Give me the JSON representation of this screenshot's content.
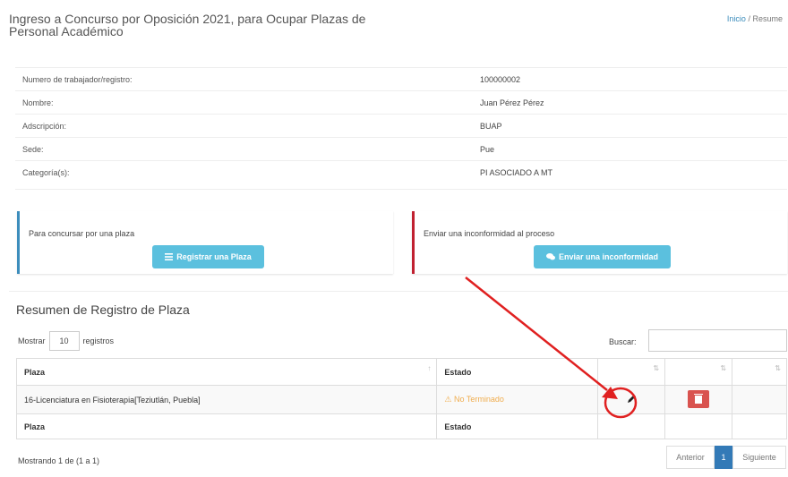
{
  "header": {
    "title": "Ingreso a Concurso por Oposición 2021, para Ocupar Plazas de Personal Académico",
    "breadcrumb_home": "Inicio",
    "breadcrumb_sep": "/",
    "breadcrumb_current": "Resume"
  },
  "info": {
    "rows": [
      {
        "label": "Numero de trabajador/registro:",
        "value": "100000002"
      },
      {
        "label": "Nombre:",
        "value": "Juan Pérez Pérez"
      },
      {
        "label": "Adscripción:",
        "value": "BUAP"
      },
      {
        "label": "Sede:",
        "value": "Pue"
      },
      {
        "label": "Categoría(s):",
        "value": "PI ASOCIADO A MT"
      }
    ]
  },
  "cards": {
    "left_text": "Para concursar por una plaza",
    "left_button": "Registrar una Plaza",
    "right_text": "Enviar una inconformidad al proceso",
    "right_button": "Enviar una inconformidad"
  },
  "section": {
    "title": "Resumen de Registro de Plaza",
    "show_label": "Mostrar",
    "show_value": "10",
    "records_label": "registros",
    "search_label": "Buscar:",
    "search_value": ""
  },
  "table": {
    "columns": [
      "Plaza",
      "Estado"
    ],
    "rows": [
      {
        "plaza": "16-Licenciatura en Fisioterapia[Teziutlán, Puebla]",
        "estado": "No Terminado"
      }
    ],
    "footer": [
      "Plaza",
      "Estado"
    ]
  },
  "pagination": {
    "info": "Mostrando 1 de (1 a 1)",
    "prev": "Anterior",
    "current": "1",
    "next": "Siguiente"
  },
  "colors": {
    "accent_blue": "#3c8dbc",
    "info_button": "#5bc0de",
    "danger": "#d9534f",
    "warning": "#f0ad4e",
    "annotation_red": "#e02020"
  }
}
